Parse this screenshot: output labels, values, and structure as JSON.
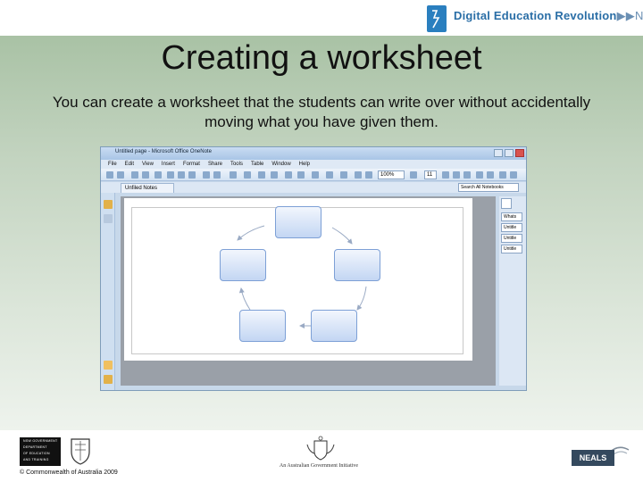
{
  "header": {
    "logo_text_bold": "Digital Education Revolution",
    "logo_text_suffix": "NSW",
    "brand_color": "#2a7fbf"
  },
  "slide": {
    "title": "Creating a worksheet",
    "subtitle": "You can create a worksheet that the students can write over without accidentally moving what you have given them."
  },
  "app": {
    "window_title": "Untitled page - Microsoft Office OneNote",
    "menu": [
      "File",
      "Edit",
      "View",
      "Insert",
      "Format",
      "Share",
      "Tools",
      "Table",
      "Window",
      "Help"
    ],
    "zoom": "100%",
    "font_size": "11",
    "section_tab": "Unfiled Notes",
    "search_placeholder": "Search All Notebooks",
    "page_tabs": [
      "Whats",
      "Untitle",
      "Untitle",
      "Untitle"
    ]
  },
  "footer": {
    "dept_logo_lines": [
      "NSW GOVERNMENT",
      "DEPARTMENT",
      "OF EDUCATION",
      "AND TRAINING"
    ],
    "gov_initiative": "An Australian Government Initiative",
    "copyright": "© Commonwealth of Australia 2009",
    "neals": "NEALS"
  }
}
